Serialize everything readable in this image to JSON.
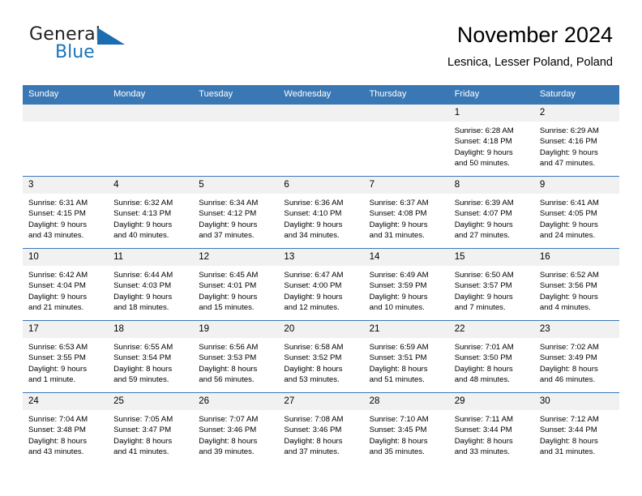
{
  "brand": {
    "name_part1": "General",
    "name_part2": "Blue",
    "triangle_color": "#1b6cb0",
    "blue_color": "#1b75bb"
  },
  "header": {
    "title": "November 2024",
    "location": "Lesnica, Lesser Poland, Poland"
  },
  "colors": {
    "header_row_bg": "#3a78b5",
    "daynum_bg": "#f1f1f1",
    "cell_bg": "#ffffff",
    "grid_line": "#3a78b5",
    "text": "#000000"
  },
  "weekday_headers": [
    "Sunday",
    "Monday",
    "Tuesday",
    "Wednesday",
    "Thursday",
    "Friday",
    "Saturday"
  ],
  "weeks": [
    [
      {
        "day": "",
        "blank": true,
        "sunrise": "",
        "sunset": "",
        "daylight_1": "",
        "daylight_2": ""
      },
      {
        "day": "",
        "blank": true,
        "sunrise": "",
        "sunset": "",
        "daylight_1": "",
        "daylight_2": ""
      },
      {
        "day": "",
        "blank": true,
        "sunrise": "",
        "sunset": "",
        "daylight_1": "",
        "daylight_2": ""
      },
      {
        "day": "",
        "blank": true,
        "sunrise": "",
        "sunset": "",
        "daylight_1": "",
        "daylight_2": ""
      },
      {
        "day": "",
        "blank": true,
        "sunrise": "",
        "sunset": "",
        "daylight_1": "",
        "daylight_2": ""
      },
      {
        "day": "1",
        "blank": false,
        "sunrise": "Sunrise: 6:28 AM",
        "sunset": "Sunset: 4:18 PM",
        "daylight_1": "Daylight: 9 hours",
        "daylight_2": "and 50 minutes."
      },
      {
        "day": "2",
        "blank": false,
        "sunrise": "Sunrise: 6:29 AM",
        "sunset": "Sunset: 4:16 PM",
        "daylight_1": "Daylight: 9 hours",
        "daylight_2": "and 47 minutes."
      }
    ],
    [
      {
        "day": "3",
        "blank": false,
        "sunrise": "Sunrise: 6:31 AM",
        "sunset": "Sunset: 4:15 PM",
        "daylight_1": "Daylight: 9 hours",
        "daylight_2": "and 43 minutes."
      },
      {
        "day": "4",
        "blank": false,
        "sunrise": "Sunrise: 6:32 AM",
        "sunset": "Sunset: 4:13 PM",
        "daylight_1": "Daylight: 9 hours",
        "daylight_2": "and 40 minutes."
      },
      {
        "day": "5",
        "blank": false,
        "sunrise": "Sunrise: 6:34 AM",
        "sunset": "Sunset: 4:12 PM",
        "daylight_1": "Daylight: 9 hours",
        "daylight_2": "and 37 minutes."
      },
      {
        "day": "6",
        "blank": false,
        "sunrise": "Sunrise: 6:36 AM",
        "sunset": "Sunset: 4:10 PM",
        "daylight_1": "Daylight: 9 hours",
        "daylight_2": "and 34 minutes."
      },
      {
        "day": "7",
        "blank": false,
        "sunrise": "Sunrise: 6:37 AM",
        "sunset": "Sunset: 4:08 PM",
        "daylight_1": "Daylight: 9 hours",
        "daylight_2": "and 31 minutes."
      },
      {
        "day": "8",
        "blank": false,
        "sunrise": "Sunrise: 6:39 AM",
        "sunset": "Sunset: 4:07 PM",
        "daylight_1": "Daylight: 9 hours",
        "daylight_2": "and 27 minutes."
      },
      {
        "day": "9",
        "blank": false,
        "sunrise": "Sunrise: 6:41 AM",
        "sunset": "Sunset: 4:05 PM",
        "daylight_1": "Daylight: 9 hours",
        "daylight_2": "and 24 minutes."
      }
    ],
    [
      {
        "day": "10",
        "blank": false,
        "sunrise": "Sunrise: 6:42 AM",
        "sunset": "Sunset: 4:04 PM",
        "daylight_1": "Daylight: 9 hours",
        "daylight_2": "and 21 minutes."
      },
      {
        "day": "11",
        "blank": false,
        "sunrise": "Sunrise: 6:44 AM",
        "sunset": "Sunset: 4:03 PM",
        "daylight_1": "Daylight: 9 hours",
        "daylight_2": "and 18 minutes."
      },
      {
        "day": "12",
        "blank": false,
        "sunrise": "Sunrise: 6:45 AM",
        "sunset": "Sunset: 4:01 PM",
        "daylight_1": "Daylight: 9 hours",
        "daylight_2": "and 15 minutes."
      },
      {
        "day": "13",
        "blank": false,
        "sunrise": "Sunrise: 6:47 AM",
        "sunset": "Sunset: 4:00 PM",
        "daylight_1": "Daylight: 9 hours",
        "daylight_2": "and 12 minutes."
      },
      {
        "day": "14",
        "blank": false,
        "sunrise": "Sunrise: 6:49 AM",
        "sunset": "Sunset: 3:59 PM",
        "daylight_1": "Daylight: 9 hours",
        "daylight_2": "and 10 minutes."
      },
      {
        "day": "15",
        "blank": false,
        "sunrise": "Sunrise: 6:50 AM",
        "sunset": "Sunset: 3:57 PM",
        "daylight_1": "Daylight: 9 hours",
        "daylight_2": "and 7 minutes."
      },
      {
        "day": "16",
        "blank": false,
        "sunrise": "Sunrise: 6:52 AM",
        "sunset": "Sunset: 3:56 PM",
        "daylight_1": "Daylight: 9 hours",
        "daylight_2": "and 4 minutes."
      }
    ],
    [
      {
        "day": "17",
        "blank": false,
        "sunrise": "Sunrise: 6:53 AM",
        "sunset": "Sunset: 3:55 PM",
        "daylight_1": "Daylight: 9 hours",
        "daylight_2": "and 1 minute."
      },
      {
        "day": "18",
        "blank": false,
        "sunrise": "Sunrise: 6:55 AM",
        "sunset": "Sunset: 3:54 PM",
        "daylight_1": "Daylight: 8 hours",
        "daylight_2": "and 59 minutes."
      },
      {
        "day": "19",
        "blank": false,
        "sunrise": "Sunrise: 6:56 AM",
        "sunset": "Sunset: 3:53 PM",
        "daylight_1": "Daylight: 8 hours",
        "daylight_2": "and 56 minutes."
      },
      {
        "day": "20",
        "blank": false,
        "sunrise": "Sunrise: 6:58 AM",
        "sunset": "Sunset: 3:52 PM",
        "daylight_1": "Daylight: 8 hours",
        "daylight_2": "and 53 minutes."
      },
      {
        "day": "21",
        "blank": false,
        "sunrise": "Sunrise: 6:59 AM",
        "sunset": "Sunset: 3:51 PM",
        "daylight_1": "Daylight: 8 hours",
        "daylight_2": "and 51 minutes."
      },
      {
        "day": "22",
        "blank": false,
        "sunrise": "Sunrise: 7:01 AM",
        "sunset": "Sunset: 3:50 PM",
        "daylight_1": "Daylight: 8 hours",
        "daylight_2": "and 48 minutes."
      },
      {
        "day": "23",
        "blank": false,
        "sunrise": "Sunrise: 7:02 AM",
        "sunset": "Sunset: 3:49 PM",
        "daylight_1": "Daylight: 8 hours",
        "daylight_2": "and 46 minutes."
      }
    ],
    [
      {
        "day": "24",
        "blank": false,
        "sunrise": "Sunrise: 7:04 AM",
        "sunset": "Sunset: 3:48 PM",
        "daylight_1": "Daylight: 8 hours",
        "daylight_2": "and 43 minutes."
      },
      {
        "day": "25",
        "blank": false,
        "sunrise": "Sunrise: 7:05 AM",
        "sunset": "Sunset: 3:47 PM",
        "daylight_1": "Daylight: 8 hours",
        "daylight_2": "and 41 minutes."
      },
      {
        "day": "26",
        "blank": false,
        "sunrise": "Sunrise: 7:07 AM",
        "sunset": "Sunset: 3:46 PM",
        "daylight_1": "Daylight: 8 hours",
        "daylight_2": "and 39 minutes."
      },
      {
        "day": "27",
        "blank": false,
        "sunrise": "Sunrise: 7:08 AM",
        "sunset": "Sunset: 3:46 PM",
        "daylight_1": "Daylight: 8 hours",
        "daylight_2": "and 37 minutes."
      },
      {
        "day": "28",
        "blank": false,
        "sunrise": "Sunrise: 7:10 AM",
        "sunset": "Sunset: 3:45 PM",
        "daylight_1": "Daylight: 8 hours",
        "daylight_2": "and 35 minutes."
      },
      {
        "day": "29",
        "blank": false,
        "sunrise": "Sunrise: 7:11 AM",
        "sunset": "Sunset: 3:44 PM",
        "daylight_1": "Daylight: 8 hours",
        "daylight_2": "and 33 minutes."
      },
      {
        "day": "30",
        "blank": false,
        "sunrise": "Sunrise: 7:12 AM",
        "sunset": "Sunset: 3:44 PM",
        "daylight_1": "Daylight: 8 hours",
        "daylight_2": "and 31 minutes."
      }
    ]
  ]
}
